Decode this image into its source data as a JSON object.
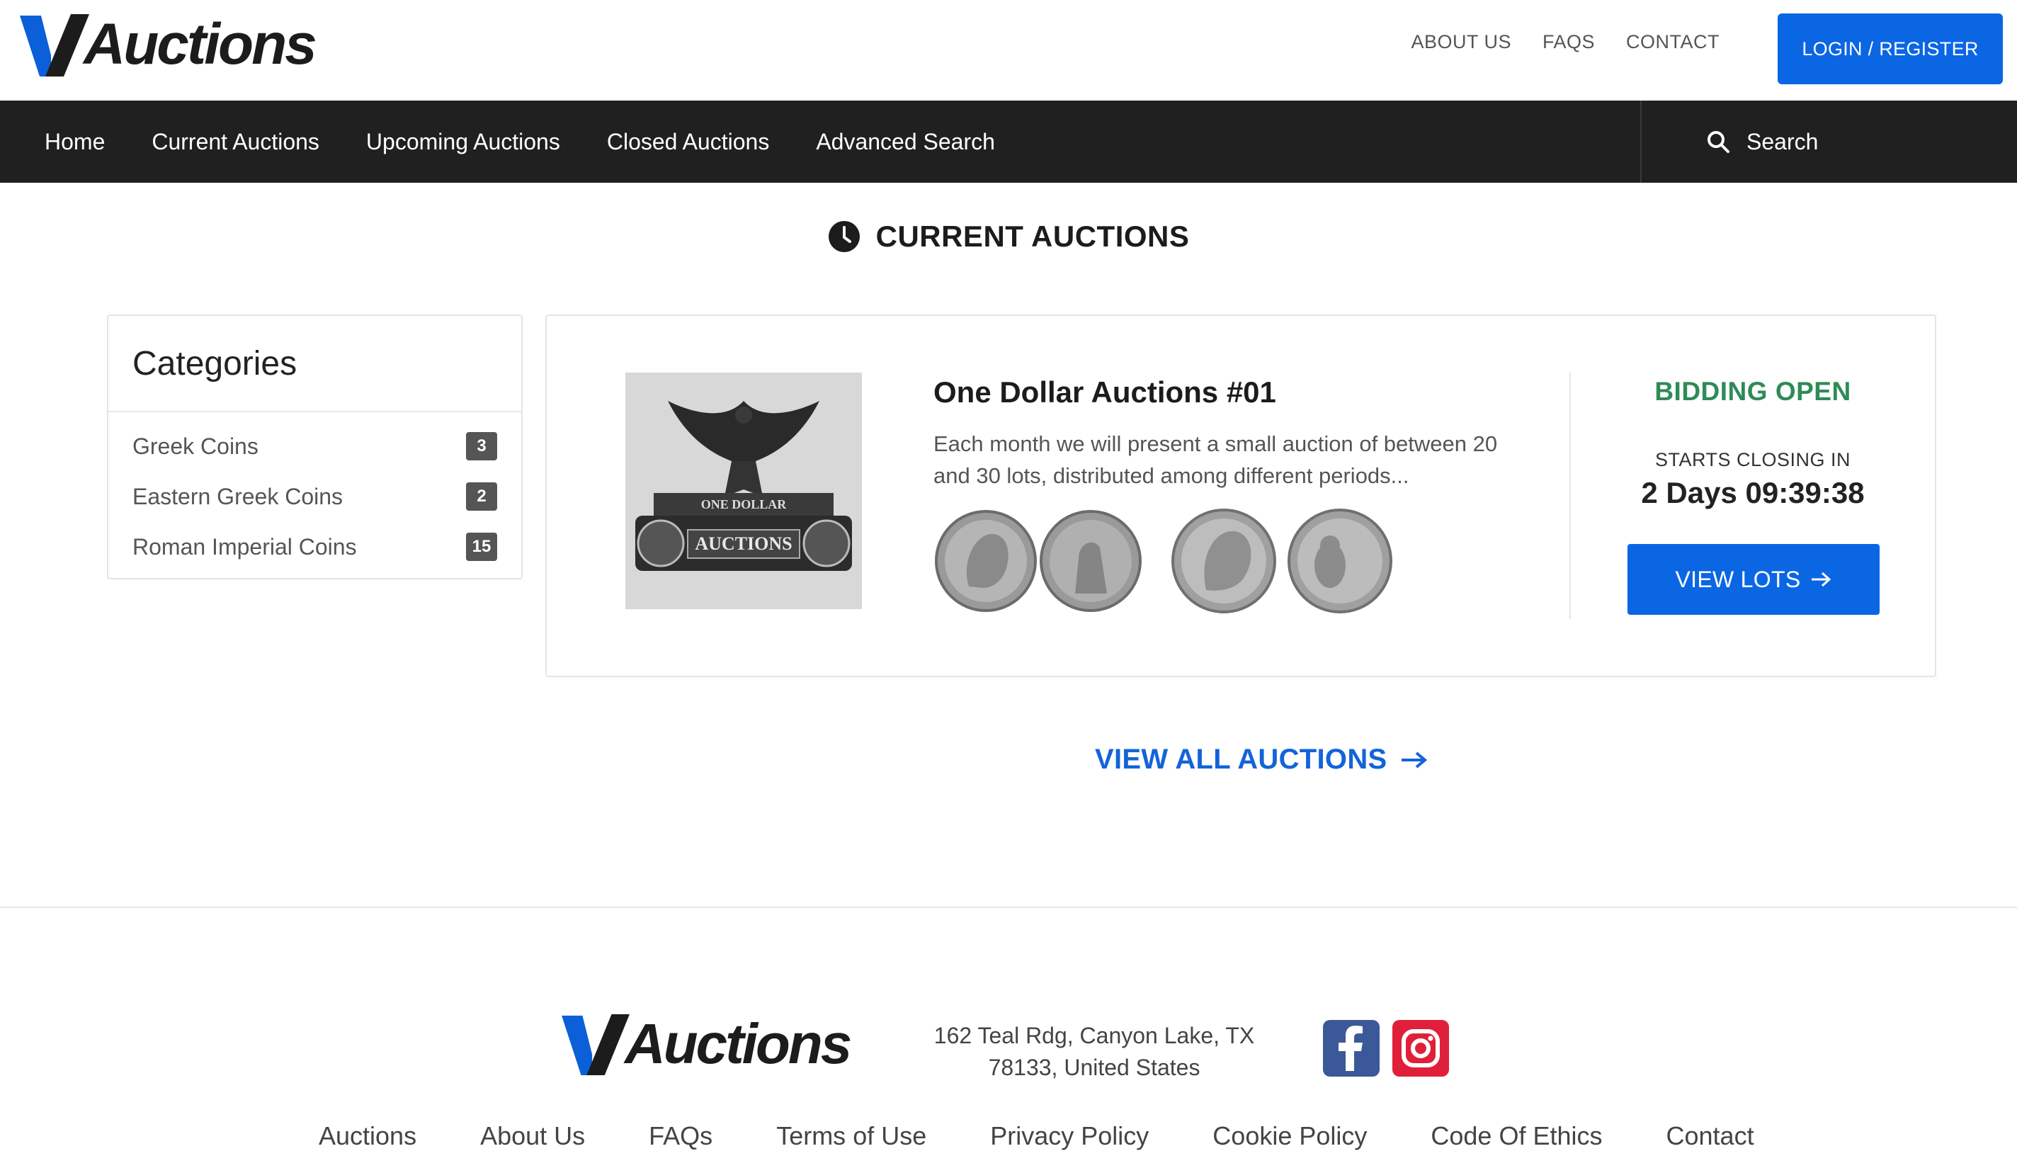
{
  "brand": {
    "logo_text": "Auctions"
  },
  "top_links": [
    "ABOUT US",
    "FAQS",
    "CONTACT"
  ],
  "login_label": "LOGIN / REGISTER",
  "nav": {
    "items": [
      "Home",
      "Current Auctions",
      "Upcoming Auctions",
      "Closed Auctions",
      "Advanced Search"
    ],
    "search_label": "Search"
  },
  "section_title": "CURRENT AUCTIONS",
  "categories": {
    "heading": "Categories",
    "items": [
      {
        "label": "Greek Coins",
        "count": "3"
      },
      {
        "label": "Eastern Greek Coins",
        "count": "2"
      },
      {
        "label": "Roman Imperial Coins",
        "count": "15"
      }
    ]
  },
  "auction": {
    "title": "One Dollar Auctions #01",
    "description": "Each month we will present a small auction of between 20 and 30 lots, distributed among different periods...",
    "image_text_top": "ONE DOLLAR",
    "image_text_main": "AUCTIONS",
    "status": "BIDDING OPEN",
    "closing_label": "STARTS CLOSING IN",
    "countdown": "2 Days 09:39:38",
    "view_lots_label": "VIEW LOTS"
  },
  "view_all_label": "VIEW ALL AUCTIONS",
  "footer": {
    "address_line1": "162 Teal Rdg, Canyon Lake, TX",
    "address_line2": "78133, United States",
    "links": [
      "Auctions",
      "About Us",
      "FAQs",
      "Terms of Use",
      "Privacy Policy",
      "Cookie Policy",
      "Code Of Ethics",
      "Contact"
    ]
  },
  "colors": {
    "primary": "#0b66e4",
    "nav_bg": "#202020",
    "status_green": "#2e8b57",
    "link_blue": "#1463d9"
  }
}
